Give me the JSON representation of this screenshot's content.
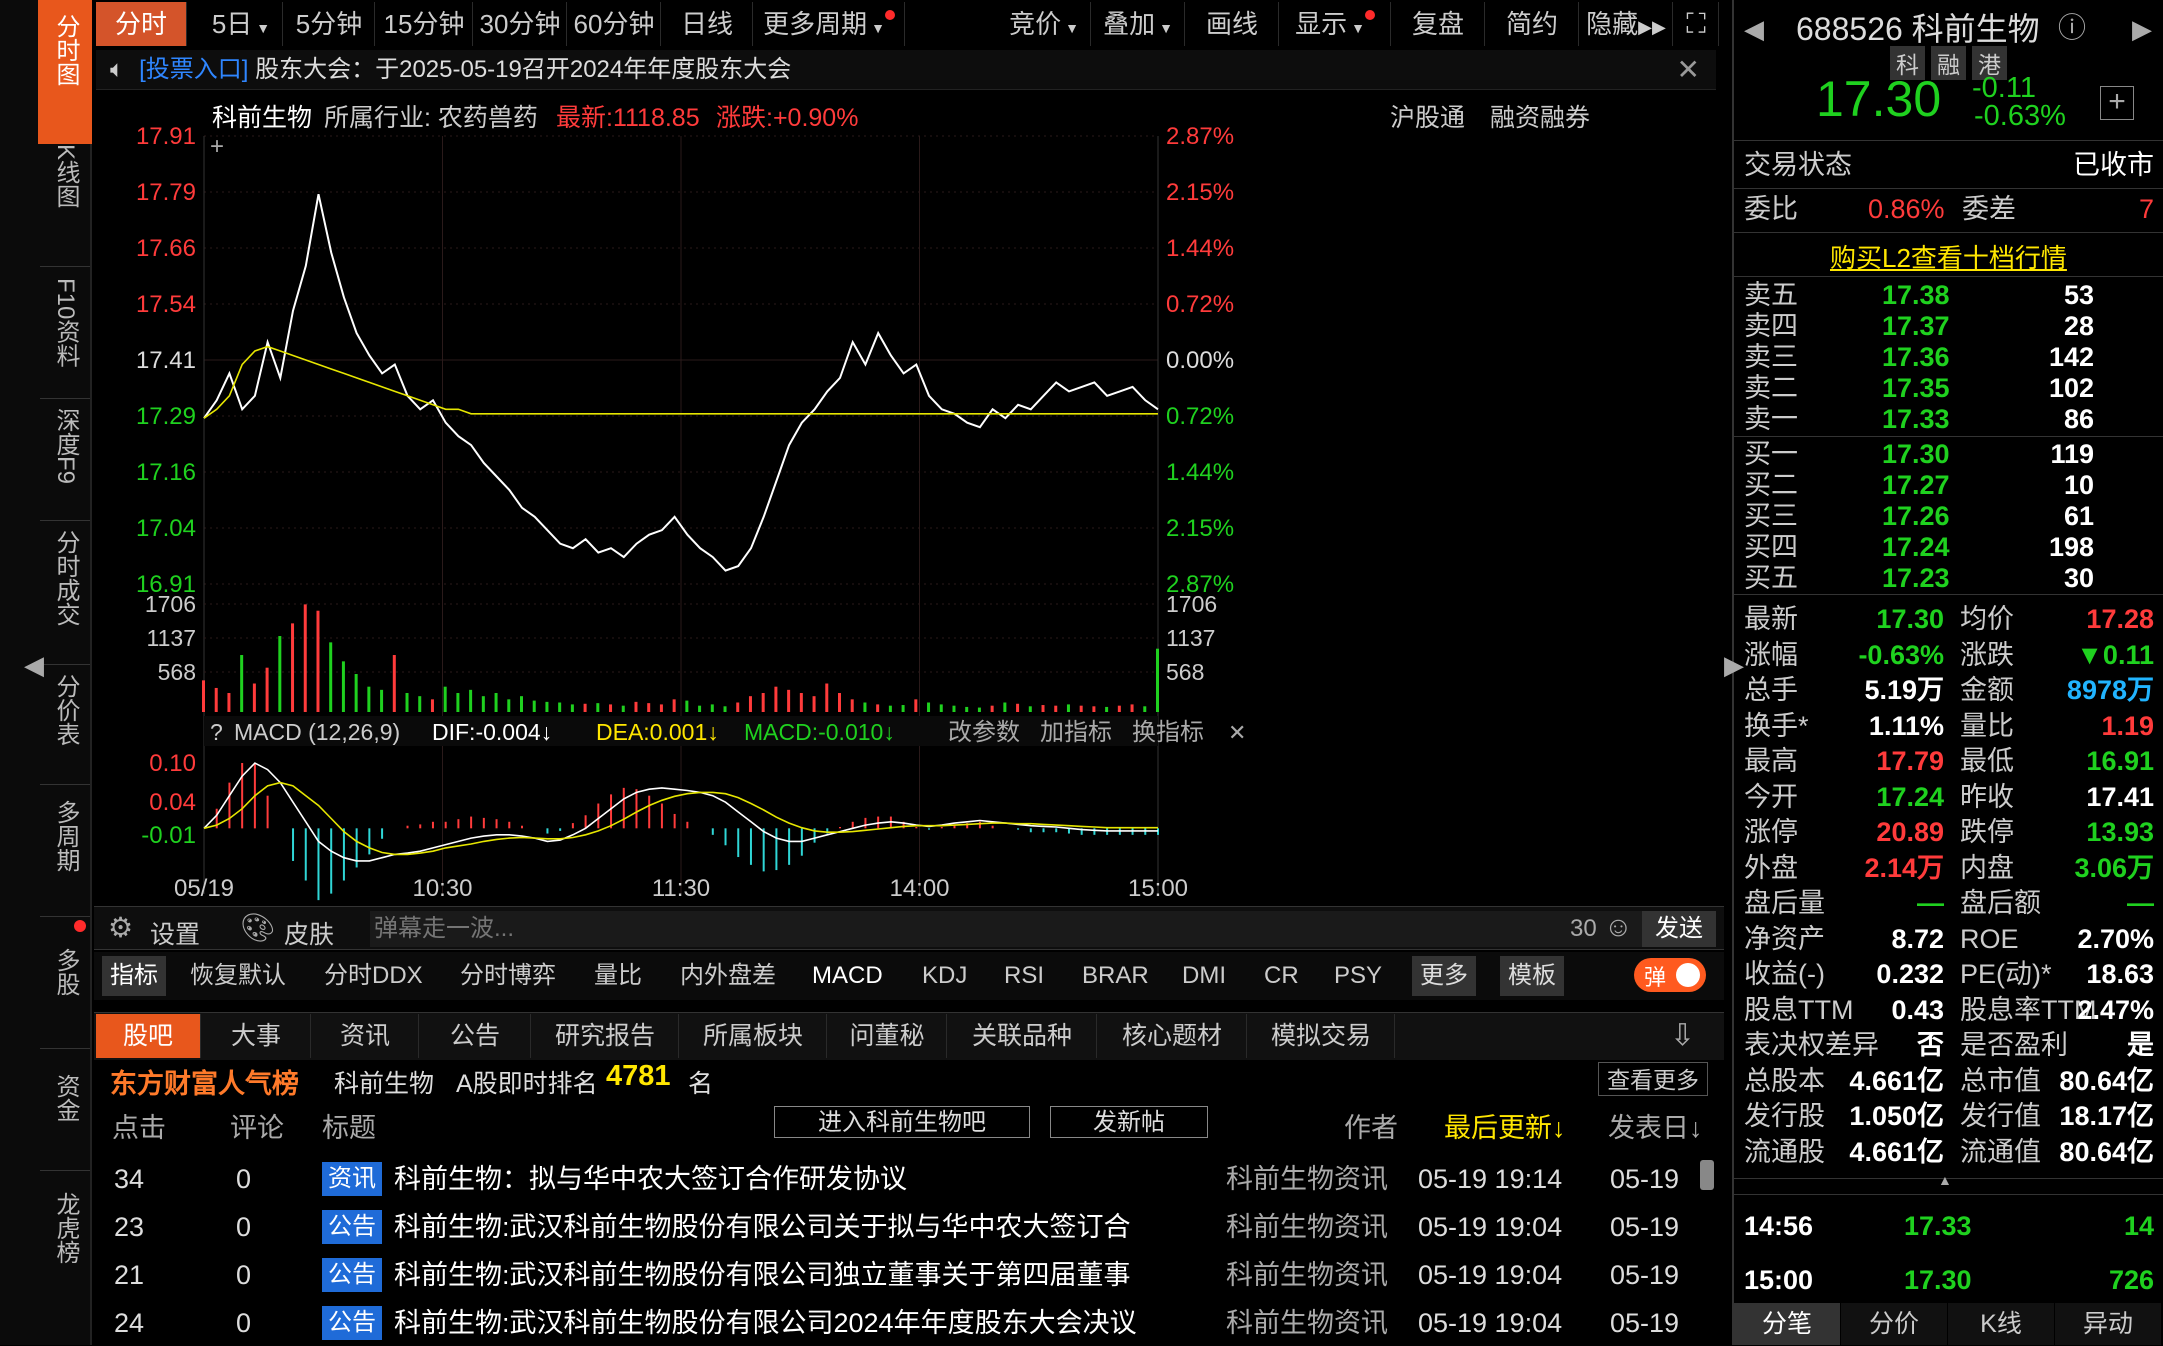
{
  "nav": {
    "items": [
      {
        "label": "分时图"
      },
      {
        "label": "K线图"
      },
      {
        "label": "F10资料"
      },
      {
        "label": "深度F9"
      },
      {
        "label": "分时成交"
      },
      {
        "label": "分价表"
      },
      {
        "label": "多周期"
      },
      {
        "label": "多股"
      },
      {
        "label": "资金"
      },
      {
        "label": "龙虎榜"
      }
    ]
  },
  "toolbar": {
    "periods": [
      "分时",
      "5日",
      "5分钟",
      "15分钟",
      "30分钟",
      "60分钟",
      "日线",
      "更多周期"
    ],
    "tools": [
      "竞价",
      "叠加",
      "画线",
      "显示",
      "复盘",
      "简约",
      "隐藏"
    ]
  },
  "notice": {
    "link": "[投票入口]",
    "text": "股东大会：于2025-05-19召开2024年年度股东大会"
  },
  "info": {
    "name": "科前生物",
    "industry": "所属行业: 农药兽药",
    "latest": "最新:1118.85",
    "change": "涨跌:+0.90%",
    "hk": "沪股通",
    "margin": "融资融券"
  },
  "chart_data": {
    "type": "line",
    "price_axis": [
      "17.91",
      "17.79",
      "17.66",
      "17.54",
      "17.41",
      "17.29",
      "17.16",
      "17.04",
      "16.91"
    ],
    "pct_axis": [
      "2.87%",
      "2.15%",
      "1.44%",
      "0.72%",
      "0.00%",
      "0.72%",
      "1.44%",
      "2.15%",
      "2.87%"
    ],
    "ylim": [
      16.91,
      17.91
    ],
    "prev_close": 17.41,
    "x_ticks": [
      "05/19",
      "10:30",
      "11:30",
      "14:00",
      "15:00"
    ],
    "series": [
      {
        "color": "#ffffff",
        "values": [
          17.28,
          17.32,
          17.38,
          17.3,
          17.33,
          17.45,
          17.37,
          17.52,
          17.62,
          17.78,
          17.65,
          17.55,
          17.47,
          17.42,
          17.38,
          17.4,
          17.33,
          17.3,
          17.32,
          17.27,
          17.24,
          17.22,
          17.18,
          17.15,
          17.12,
          17.08,
          17.06,
          17.03,
          17.0,
          16.99,
          17.01,
          16.98,
          16.99,
          16.97,
          17.0,
          17.02,
          17.03,
          17.06,
          17.02,
          16.99,
          16.97,
          16.94,
          16.95,
          16.99,
          17.06,
          17.14,
          17.22,
          17.27,
          17.3,
          17.34,
          17.37,
          17.45,
          17.4,
          17.47,
          17.42,
          17.38,
          17.4,
          17.33,
          17.3,
          17.29,
          17.27,
          17.26,
          17.3,
          17.28,
          17.31,
          17.3,
          17.33,
          17.36,
          17.34,
          17.35,
          17.36,
          17.33,
          17.34,
          17.35,
          17.32,
          17.3
        ]
      },
      {
        "color": "#e6e600",
        "values": [
          17.28,
          17.3,
          17.33,
          17.4,
          17.43,
          17.44,
          17.43,
          17.42,
          17.41,
          17.4,
          17.39,
          17.38,
          17.37,
          17.36,
          17.35,
          17.34,
          17.33,
          17.32,
          17.31,
          17.3,
          17.3,
          17.29,
          17.29,
          17.29,
          17.29,
          17.29,
          17.29,
          17.29,
          17.29,
          17.29,
          17.29,
          17.29,
          17.29,
          17.29,
          17.29,
          17.29,
          17.29,
          17.29,
          17.29,
          17.29,
          17.29,
          17.29,
          17.29,
          17.29,
          17.29,
          17.29,
          17.29,
          17.29,
          17.29,
          17.29,
          17.29,
          17.29,
          17.29,
          17.29,
          17.29,
          17.29,
          17.29,
          17.29,
          17.29,
          17.29,
          17.29,
          17.29,
          17.29,
          17.29,
          17.29,
          17.29,
          17.29,
          17.29,
          17.29,
          17.29,
          17.29,
          17.29,
          17.29,
          17.29,
          17.29,
          17.29
        ]
      }
    ],
    "volume_axis": [
      "1706",
      "1137",
      "568"
    ],
    "volume_values": [
      500,
      380,
      300,
      900,
      450,
      700,
      1200,
      1400,
      1700,
      1600,
      1100,
      800,
      600,
      400,
      350,
      900,
      300,
      250,
      200,
      400,
      300,
      350,
      250,
      300,
      200,
      250,
      180,
      160,
      150,
      120,
      130,
      140,
      120,
      100,
      160,
      140,
      120,
      200,
      180,
      100,
      120,
      90,
      150,
      250,
      300,
      400,
      350,
      300,
      250,
      450,
      300,
      200,
      150,
      120,
      100,
      110,
      200,
      150,
      120,
      100,
      80,
      70,
      100,
      150,
      130,
      90,
      110,
      100,
      120,
      100,
      90,
      80,
      100,
      120,
      90,
      1000
    ],
    "macd": {
      "label": "MACD (12,26,9)",
      "dif": "DIF:-0.004↓",
      "dea": "DEA:0.001↓",
      "macd": "MACD:-0.010↓",
      "axis": [
        "0.10",
        "0.04",
        "-0.01"
      ],
      "dif_values": [
        0.0,
        0.02,
        0.05,
        0.08,
        0.1,
        0.09,
        0.07,
        0.04,
        0.01,
        -0.02,
        -0.035,
        -0.045,
        -0.05,
        -0.05,
        -0.045,
        -0.04,
        -0.038,
        -0.035,
        -0.03,
        -0.025,
        -0.02,
        -0.015,
        -0.012,
        -0.01,
        -0.01,
        -0.012,
        -0.015,
        -0.02,
        -0.018,
        -0.01,
        0.0,
        0.015,
        0.03,
        0.045,
        0.055,
        0.06,
        0.062,
        0.06,
        0.058,
        0.055,
        0.05,
        0.04,
        0.025,
        0.01,
        -0.005,
        -0.015,
        -0.02,
        -0.02,
        -0.015,
        -0.01,
        -0.005,
        0.0,
        0.005,
        0.008,
        0.01,
        0.008,
        0.005,
        0.003,
        0.005,
        0.008,
        0.01,
        0.012,
        0.01,
        0.008,
        0.006,
        0.004,
        0.003,
        0.002,
        0.0,
        -0.002,
        -0.003,
        -0.004,
        -0.004,
        -0.004,
        -0.004,
        -0.004
      ],
      "dea_values": [
        0.0,
        0.005,
        0.015,
        0.03,
        0.05,
        0.065,
        0.07,
        0.065,
        0.05,
        0.035,
        0.015,
        -0.005,
        -0.02,
        -0.03,
        -0.037,
        -0.04,
        -0.04,
        -0.038,
        -0.035,
        -0.03,
        -0.027,
        -0.024,
        -0.02,
        -0.017,
        -0.015,
        -0.014,
        -0.015,
        -0.016,
        -0.016,
        -0.014,
        -0.01,
        -0.004,
        0.004,
        0.014,
        0.025,
        0.035,
        0.043,
        0.049,
        0.053,
        0.055,
        0.055,
        0.053,
        0.047,
        0.038,
        0.028,
        0.017,
        0.008,
        0.001,
        -0.004,
        -0.006,
        -0.006,
        -0.005,
        -0.003,
        -0.001,
        0.001,
        0.003,
        0.004,
        0.004,
        0.004,
        0.005,
        0.006,
        0.007,
        0.008,
        0.008,
        0.007,
        0.007,
        0.006,
        0.005,
        0.004,
        0.003,
        0.002,
        0.001,
        0.001,
        0.001,
        0.001,
        0.001
      ]
    }
  },
  "chart_tools": {
    "change_params": "改参数",
    "add_indicator": "加指标",
    "switch_indicator": "换指标"
  },
  "bottom_bar": {
    "settings": "设置",
    "skin": "皮肤",
    "danmu_placeholder": "弹幕走一波...",
    "count": "30",
    "send": "发送"
  },
  "indicator_tabs": [
    "指标",
    "恢复默认",
    "分时DDX",
    "分时博弈",
    "量比",
    "内外盘差",
    "MACD",
    "KDJ",
    "RSI",
    "BRAR",
    "DMI",
    "CR",
    "PSY",
    "更多",
    "模板"
  ],
  "toggle_label": "弹",
  "news_tabs": [
    "股吧",
    "大事",
    "资讯",
    "公告",
    "研究报告",
    "所属板块",
    "问董秘",
    "关联品种",
    "核心题材",
    "模拟交易"
  ],
  "popularity": {
    "brand": "东方财富人气榜",
    "name": "科前生物",
    "rank_label": "A股即时排名",
    "rank": "4781",
    "unit": "名",
    "more": "查看更多"
  },
  "news_header": {
    "clicks": "点击",
    "comments": "评论",
    "title": "标题",
    "enter": "进入科前生物吧",
    "post": "发新帖",
    "author": "作者",
    "updated": "最后更新↓",
    "published": "发表日↓"
  },
  "news_rows": [
    {
      "clicks": "34",
      "comments": "0",
      "tag": "资讯",
      "title": "科前生物：拟与华中农大签订合作研发协议",
      "author": "科前生物资讯",
      "updated": "05-19 19:14",
      "published": "05-19"
    },
    {
      "clicks": "23",
      "comments": "0",
      "tag": "公告",
      "title": "科前生物:武汉科前生物股份有限公司关于拟与华中农大签订合",
      "author": "科前生物资讯",
      "updated": "05-19 19:04",
      "published": "05-19"
    },
    {
      "clicks": "21",
      "comments": "0",
      "tag": "公告",
      "title": "科前生物:武汉科前生物股份有限公司独立董事关于第四届董事",
      "author": "科前生物资讯",
      "updated": "05-19 19:04",
      "published": "05-19"
    },
    {
      "clicks": "24",
      "comments": "0",
      "tag": "公告",
      "title": "科前生物:武汉科前生物股份有限公司2024年年度股东大会决议",
      "author": "科前生物资讯",
      "updated": "05-19 19:04",
      "published": "05-19"
    }
  ],
  "quote": {
    "code_name": "688526 科前生物",
    "badges": [
      "科",
      "融",
      "港"
    ],
    "price": "17.30",
    "chg": "-0.11",
    "pct": "-0.63%",
    "status_label": "交易状态",
    "status": "已收市",
    "wb_label": "委比",
    "wb": "0.86%",
    "wc_label": "委差",
    "wc": "7",
    "l2": "购买L2查看十档行情",
    "asks": [
      {
        "label": "卖五",
        "price": "17.38",
        "vol": "53"
      },
      {
        "label": "卖四",
        "price": "17.37",
        "vol": "28"
      },
      {
        "label": "卖三",
        "price": "17.36",
        "vol": "142"
      },
      {
        "label": "卖二",
        "price": "17.35",
        "vol": "102"
      },
      {
        "label": "卖一",
        "price": "17.33",
        "vol": "86"
      }
    ],
    "bids": [
      {
        "label": "买一",
        "price": "17.30",
        "vol": "119"
      },
      {
        "label": "买二",
        "price": "17.27",
        "vol": "10"
      },
      {
        "label": "买三",
        "price": "17.26",
        "vol": "61"
      },
      {
        "label": "买四",
        "price": "17.24",
        "vol": "198"
      },
      {
        "label": "买五",
        "price": "17.23",
        "vol": "30"
      }
    ],
    "stats": [
      [
        "最新",
        "17.30",
        "均价",
        "17.28"
      ],
      [
        "涨幅",
        "-0.63%",
        "涨跌",
        "▼0.11"
      ],
      [
        "总手",
        "5.19万",
        "金额",
        "8978万"
      ],
      [
        "换手*",
        "1.11%",
        "量比",
        "1.19"
      ],
      [
        "最高",
        "17.79",
        "最低",
        "16.91"
      ],
      [
        "今开",
        "17.24",
        "昨收",
        "17.41"
      ],
      [
        "涨停",
        "20.89",
        "跌停",
        "13.93"
      ],
      [
        "外盘",
        "2.14万",
        "内盘",
        "3.06万"
      ],
      [
        "盘后量",
        "—",
        "盘后额",
        "—"
      ],
      [
        "净资产",
        "8.72",
        "ROE",
        "2.70%"
      ],
      [
        "收益(-)",
        "0.232",
        "PE(动)*",
        "18.63"
      ],
      [
        "股息TTM",
        "0.43",
        "股息率TTM",
        "2.47%"
      ],
      [
        "表决权差异",
        "否",
        "是否盈利",
        "是"
      ],
      [
        "总股本",
        "4.661亿",
        "总市值",
        "80.64亿"
      ],
      [
        "发行股",
        "1.050亿",
        "发行值",
        "18.17亿"
      ],
      [
        "流通股",
        "4.661亿",
        "流通值",
        "80.64亿"
      ]
    ],
    "ticks": [
      {
        "time": "14:56",
        "price": "17.33",
        "vol": "14"
      },
      {
        "time": "15:00",
        "price": "17.30",
        "vol": "726"
      }
    ],
    "bottom_tabs": [
      "分笔",
      "分价",
      "K线",
      "异动"
    ]
  },
  "colors": {
    "up": "#ff3b3b",
    "down": "#1fd11f",
    "accent": "#e8571c",
    "price_line": "#ffffff",
    "avg_line": "#e6e600"
  }
}
